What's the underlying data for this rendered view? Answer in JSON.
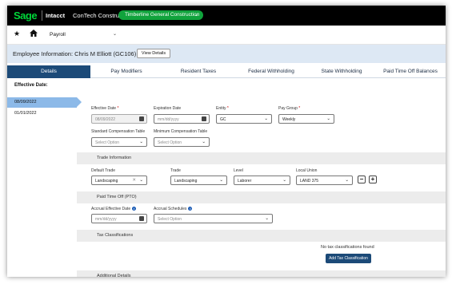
{
  "app": {
    "logo": "Sage",
    "product": "Intacct",
    "company": "ConTech Construction",
    "entity": "Timberline General Construction"
  },
  "nav": {
    "module": "Payroll",
    "icons": [
      "star-icon",
      "home-icon",
      "chevron-down-icon"
    ]
  },
  "employee": {
    "title": "Employee Information: Chris M Elliott (GC106)",
    "view_details_label": "View Details"
  },
  "tabs": [
    {
      "label": "Details",
      "active": true
    },
    {
      "label": "Pay Modifiers",
      "active": false
    },
    {
      "label": "Resident Taxes",
      "active": false
    },
    {
      "label": "Federal Withholding",
      "active": false
    },
    {
      "label": "State Withholding",
      "active": false
    },
    {
      "label": "Paid Time Off Balances",
      "active": false
    }
  ],
  "sidebar": {
    "heading": "Effective Date:",
    "items": [
      {
        "label": "08/09/2022",
        "selected": true
      },
      {
        "label": "01/01/2022",
        "selected": false
      }
    ]
  },
  "form": {
    "effective_date": {
      "label": "Effective Date",
      "required": "*",
      "value": "08/09/2022"
    },
    "expiration_date": {
      "label": "Expiration Date",
      "placeholder": "mm/dd/yyyy"
    },
    "entity": {
      "label": "Entity",
      "required": "*",
      "value": "GC"
    },
    "pay_group": {
      "label": "Pay Group",
      "required": "*",
      "value": "Weekly"
    },
    "std_comp_table": {
      "label": "Standard Compensation Table",
      "placeholder": "Select Option"
    },
    "min_comp_table": {
      "label": "Minimum Compensation Table",
      "placeholder": "Select Option"
    }
  },
  "trade": {
    "section_title": "Trade Information",
    "default_trade": {
      "label": "Default Trade",
      "value": "Landscaping"
    },
    "trade": {
      "label": "Trade",
      "value": "Landscaping"
    },
    "level": {
      "label": "Level",
      "value": "Laborer"
    },
    "local_union": {
      "label": "Local Union",
      "value": "LAND 375"
    },
    "remove_label": "−",
    "add_label": "+"
  },
  "pto": {
    "section_title": "Paid Time Off (PTO)",
    "accrual_date": {
      "label": "Accrual Effective Date",
      "placeholder": "mm/dd/yyyy"
    },
    "accrual_schedules": {
      "label": "Accrual Schedules",
      "placeholder": "Select Option"
    }
  },
  "tax": {
    "section_title": "Tax Classifications",
    "empty_message": "No tax classifications found",
    "add_button_label": "Add Tax Classification"
  },
  "additional": {
    "section_title": "Additional Details"
  },
  "colors": {
    "brand_green": "#00d639",
    "entity_pill": "#10a33c",
    "primary_blue": "#1c4a78",
    "selected_date": "#8cb9e8",
    "header_band": "#dde8f4"
  }
}
